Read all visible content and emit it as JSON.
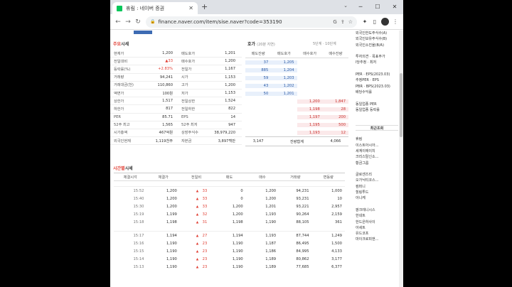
{
  "browser": {
    "tab_title": "휴림 : 네이버 증권",
    "new_tab": "+",
    "url": "finance.naver.com/item/sise.naver?code=353190",
    "win_min": "─",
    "win_max": "☐",
    "win_close": "✕",
    "tab_close": "✕",
    "dropdown": "⌄"
  },
  "summary": {
    "title": "주요",
    "title_rest": "시세",
    "rows": [
      {
        "l": "현재가",
        "v": "1,200",
        "l2": "매도호가",
        "v2": "1,201"
      },
      {
        "l": "전일대비",
        "v": "▲33",
        "l2": "매수호가",
        "v2": "1,200"
      },
      {
        "l": "등락률(%)",
        "v": "+2.83%",
        "l2": "전일가",
        "v2": "1,167"
      },
      {
        "l": "거래량",
        "v": "94,241",
        "l2": "시가",
        "v2": "1,153"
      },
      {
        "l": "거래대금(천)",
        "v": "110,860",
        "l2": "고가",
        "v2": "1,200"
      },
      {
        "l": "액면가",
        "v": "100원",
        "l2": "저가",
        "v2": "1,153"
      },
      {
        "l": "상한가",
        "v": "1,517",
        "l2": "전일상한",
        "v2": "1,524"
      },
      {
        "l": "하한가",
        "v": "817",
        "l2": "전일하한",
        "v2": "822"
      },
      {
        "l": "PER",
        "v": "85.71",
        "l2": "EPS",
        "v2": "14"
      },
      {
        "l": "52주 최고",
        "v": "1,565",
        "l2": "52주 최저",
        "v2": "947"
      },
      {
        "l": "시가총액",
        "v": "467억원",
        "l2": "상장주식수",
        "v2": "38,979,220"
      },
      {
        "l": "외국인현재",
        "v": "1,119천주",
        "l2": "자본금",
        "v2": "3,897백만"
      }
    ]
  },
  "hoga": {
    "title": "호가",
    "subtitle": "(20분 지연)",
    "links": "5단계 · 10단계",
    "headers": [
      "매도잔량",
      "매도호가",
      "매수호가",
      "매수잔량"
    ],
    "sell": [
      {
        "q": "37",
        "p": "1,205"
      },
      {
        "q": "885",
        "p": "1,204"
      },
      {
        "q": "59",
        "p": "1,203"
      },
      {
        "q": "43",
        "p": "1,202"
      },
      {
        "q": "50",
        "p": "1,201"
      }
    ],
    "buy": [
      {
        "p": "1,200",
        "q": "1,847"
      },
      {
        "p": "1,198",
        "q": "28"
      },
      {
        "p": "1,197",
        "q": "200"
      },
      {
        "p": "1,195",
        "q": "500"
      },
      {
        "p": "1,193",
        "q": "12"
      }
    ],
    "sum_sell": "3,147",
    "sum_label": "잔량합계",
    "sum_buy": "4,066"
  },
  "trade": {
    "title": "시간별",
    "title_rest": "시세",
    "headers": [
      "체결시각",
      "체결가",
      "전일비",
      "매도",
      "매수",
      "거래량",
      "변동량"
    ],
    "rows": [
      [
        "15:52",
        "1,200",
        "33",
        "0",
        "1,200",
        "94,231",
        "1,000"
      ],
      [
        "15:40",
        "1,200",
        "33",
        "0",
        "1,200",
        "93,231",
        "10"
      ],
      [
        "15:30",
        "1,200",
        "33",
        "1,200",
        "1,201",
        "93,221",
        "2,957"
      ],
      [
        "15:19",
        "1,199",
        "32",
        "1,200",
        "1,193",
        "90,264",
        "2,159"
      ],
      [
        "15:18",
        "1,198",
        "31",
        "1,198",
        "1,190",
        "88,105",
        "361"
      ],
      [
        "15:17",
        "1,194",
        "27",
        "1,194",
        "1,193",
        "87,744",
        "1,249"
      ],
      [
        "15:16",
        "1,190",
        "23",
        "1,190",
        "1,187",
        "86,495",
        "1,500"
      ],
      [
        "15:15",
        "1,190",
        "23",
        "1,190",
        "1,186",
        "84,995",
        "4,133"
      ],
      [
        "15:14",
        "1,190",
        "23",
        "1,190",
        "1,189",
        "80,862",
        "3,177"
      ],
      [
        "15:13",
        "1,190",
        "23",
        "1,190",
        "1,189",
        "77,685",
        "6,377"
      ]
    ]
  },
  "right": {
    "items": [
      "외국인한도주식수(A)",
      "외국인보유주식수(B)",
      "외국인소진율(B/A)",
      "",
      "투자의견 · 목표주가",
      "l당추정 · 최저",
      "",
      "PER · EPS(2023.03)",
      "추정PER · EPS",
      "PBR · BPS(2023.03)",
      "배당수익률",
      "",
      "동일업종 PER",
      "동일업종 등락률",
      "",
      "",
      "최근조회",
      "",
      "휴림",
      "이스트아시아...",
      "세계이에이치",
      "크리스탈신소...",
      "황금그룹",
      "",
      "글로센즈리",
      "오가닉티코스...",
      "컴퍼니",
      "힐링투드",
      "아니케",
      "",
      "팡크레니시스",
      "한네트",
      "한드은하사이",
      "아세트",
      "유드코프",
      "마이크로피앤..."
    ]
  }
}
